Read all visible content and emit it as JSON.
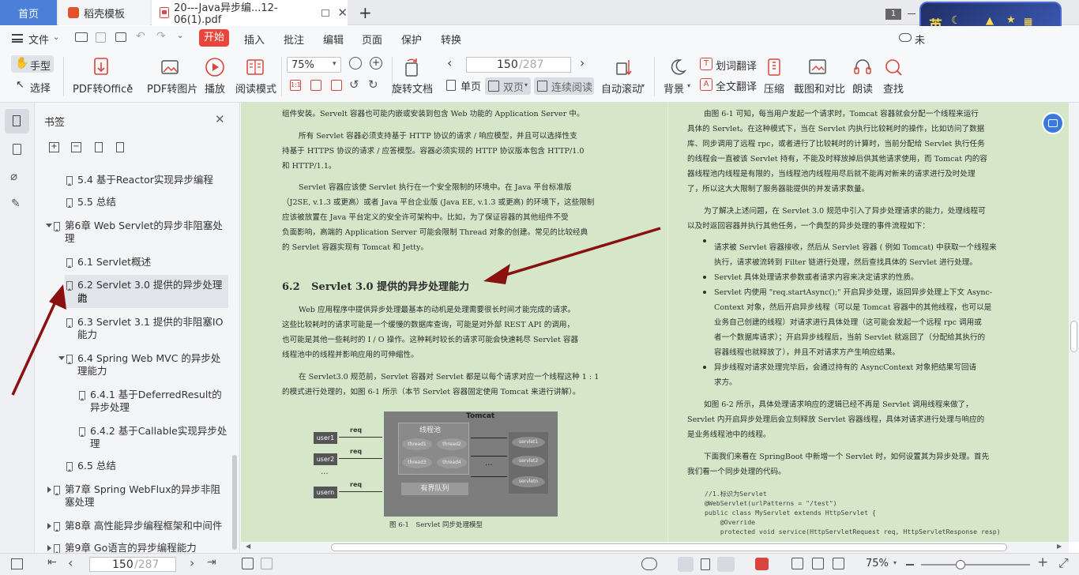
{
  "tabs": {
    "home": "首页",
    "template": "稻壳模板",
    "file": "20---Java异步编...12-06(1).pdf",
    "count": "1"
  },
  "ime": {
    "label": "英"
  },
  "menu": {
    "file": "文件",
    "start": "开始",
    "insert": "插入",
    "annotate": "批注",
    "edit": "编辑",
    "page": "页面",
    "protect": "保护",
    "convert": "转换",
    "cloud": "未"
  },
  "toolbar": {
    "hand": "手型",
    "select": "选择",
    "pdf_to_office": "PDF转Office",
    "pdf_to_image": "PDF转图片",
    "play": "播放",
    "read_mode": "阅读模式",
    "zoom": "75%",
    "page_current": "150",
    "page_total": "/287",
    "rotate": "旋转文档",
    "single": "单页",
    "double": "双页",
    "continuous": "连续阅读",
    "auto_scroll": "自动滚动",
    "background": "背景",
    "word_translate": "划词翻译",
    "full_translate": "全文翻译",
    "compress": "压缩",
    "screenshot": "截图和对比",
    "read_aloud": "朗读",
    "find": "查找"
  },
  "bookmarks": {
    "title": "书签",
    "items": [
      {
        "label": "5.4 基于Reactor实现异步编程"
      },
      {
        "label": "5.5 总结"
      },
      {
        "label": "第6章 Web Servlet的异步非阻塞处",
        "label2": "理"
      },
      {
        "label": "6.1 Servlet概述"
      },
      {
        "label": "6.2 Servlet 3.0 提供的异步处理能",
        "label2": "力"
      },
      {
        "label": "6.3 Servlet 3.1 提供的非阻塞IO",
        "label2": "能力"
      },
      {
        "label": "6.4 Spring Web MVC 的异步处",
        "label2": "理能力"
      },
      {
        "label": "6.4.1 基于DeferredResult的",
        "label2": "异步处理"
      },
      {
        "label": "6.4.2 基于Callable实现异步处",
        "label2": "理"
      },
      {
        "label": "6.5 总结"
      },
      {
        "label": "第7章 Spring WebFlux的异步非阻",
        "label2": "塞处理"
      },
      {
        "label": "第8章 高性能异步编程框架和中间件"
      },
      {
        "label": "第9章 Go语言的异步编程能力"
      }
    ]
  },
  "left_page": {
    "lines": [
      "组件安装。Servelt 容器也可能内嵌或安装到包含 Web 功能的 Application Server 中。",
      "所有 Servlet 容器必须支持基于 HTTP 协议的请求 / 响应模型，并且可以选择性支",
      "持基于 HTTPS 协议的请求 / 应答模型。容器必须实现的 HTTP 协议版本包含 HTTP/1.0",
      "和 HTTP/1.1。",
      "Servlet 容器应该使 Servlet 执行在一个安全限制的环境中。在 Java 平台标准版",
      "（J2SE, v.1.3 或更高）或者 Java 平台企业版 (Java EE, v.1.3 或更高) 的环境下，这些限制",
      "应该被放置在 Java 平台定义的安全许可架构中。比如，为了保证容器的其他组件不受",
      "负面影响，高端的 Application Server 可能会限制 Thread 对象的创建。常见的比较经典",
      "的 Servlet 容器实现有 Tomcat 和 Jetty。",
      "Web 应用程序中提供异步处理最基本的动机是处理需要很长时间才能完成的请求。",
      "这些比较耗时的请求可能是一个缓慢的数据库查询，可能是对外部 REST API 的调用，",
      "也可能是其他一些耗时的 I / O 操作。这种耗时较长的请求可能会快速耗尽 Servlet 容器",
      "线程池中的线程并影响应用的可伸缩性。",
      "在 Servlet3.0 规范前，Servlet 容器对 Servlet 都是以每个请求对应一个线程这种 1 : 1",
      "的模式进行处理的，如图 6-1 所示（本节 Servlet 容器固定使用 Tomcat 来进行讲解）。"
    ],
    "heading_num": "6.2",
    "heading": "Servlet 3.0 提供的异步处理能力",
    "figure": {
      "tomcat": "Tomcat",
      "pool": "线程池",
      "threads": [
        "thread1",
        "thread2",
        "thread3",
        "thread4"
      ],
      "servlets": [
        "servlet1",
        "servlet2",
        "servletn"
      ],
      "users": [
        "user1",
        "user2",
        "usern"
      ],
      "req": "req",
      "dots": "...",
      "queue": "有界队列",
      "caption": "图 6-1　Servlet 同步处理模型"
    }
  },
  "right_page": {
    "lines": [
      "由图 6-1 可知，每当用户发起一个请求时，Tomcat 容器就会分配一个线程来运行",
      "具体的 Servlet。在这种模式下，当在 Servlet 内执行比较耗时的操作，比如访问了数据",
      "库、同步调用了远程 rpc，或者进行了比较耗时的计算时，当前分配给 Servlet 执行任务",
      "的线程会一直被该 Servlet 持有，不能及时释放掉后供其他请求使用，而 Tomcat 内的容",
      "器线程池内线程是有限的，当线程池内线程用尽后就不能再对新来的请求进行及时处理",
      "了，所以这大大限制了服务器能提供的并发请求数量。",
      "为了解决上述问题，在 Servlet 3.0 规范中引入了异步处理请求的能力，处理线程可",
      "以及时返回容器并执行其他任务，一个典型的异步处理的事件流程如下：",
      "请求被 Servlet 容器接收，然后从 Servlet 容器 ( 例如 Tomcat) 中获取一个线程来",
      "执行，请求被流转到 Filter 链进行处理，然后查找具体的 Servlet 进行处理。",
      "Servlet 具体处理请求参数或者请求内容来决定请求的性质。",
      "Servlet 内使用 \"req.startAsync();\" 开启异步处理，返回异步处理上下文 Async-",
      "Context 对象，然后开启异步线程（可以是 Tomcat 容器中的其他线程，也可以是",
      "业务自己创建的线程）对请求进行具体处理（这可能会发起一个远程 rpc 调用或",
      "者一个数据库请求）；开启异步线程后，当前 Servlet 就返回了（分配给其执行的",
      "容器线程也就释放了），并且不对请求方产生响应结果。",
      "异步线程对请求处理完毕后，会通过持有的 AsyncContext 对象把结果写回请",
      "求方。",
      "如图 6-2 所示，具体处理请求响应的逻辑已经不再是 Servlet 调用线程来做了，",
      "Servlet 内开启异步处理后会立刻释放 Servlet 容器线程，具体对请求进行处理与响应的",
      "是业务线程池中的线程。",
      "下面我们来看在 SpringBoot 中新增一个 Servlet 时，如何设置其为异步处理。首先",
      "我们看一个同步处理的代码。"
    ],
    "code": [
      "//1.标识为Servlet",
      "@WebServlet(urlPatterns = \"/test\")",
      "public class MyServlet extends HttpServlet {",
      "    @Override",
      "    protected void service(HttpServletRequest req, HttpServletResponse resp)"
    ]
  },
  "status": {
    "page_current": "150",
    "page_total": "/287",
    "zoom": "75%"
  },
  "colors": {
    "accent": "#e8453c",
    "home_tab": "#4b7fd8",
    "doc_bg": "#d6e7c9",
    "arrow": "#8b1010"
  }
}
